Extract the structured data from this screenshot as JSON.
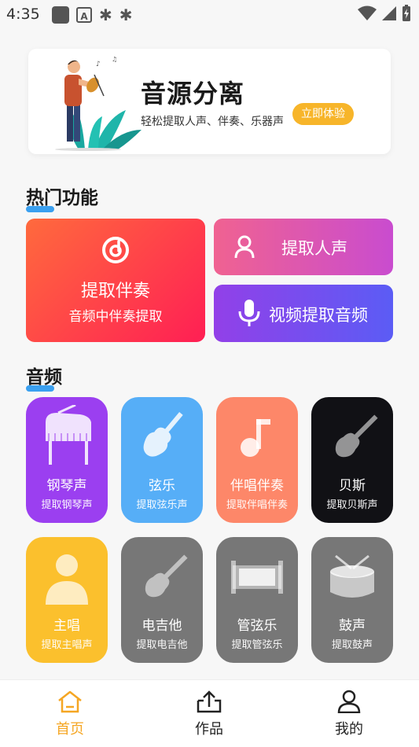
{
  "status_bar": {
    "time": "4:35"
  },
  "banner": {
    "title": "音源分离",
    "subtitle": "轻松提取人声、伴奏、乐器声",
    "button": "立即体验"
  },
  "hot": {
    "title": "热门功能",
    "big": {
      "title": "提取伴奏",
      "subtitle": "音频中伴奏提取"
    },
    "vocal": {
      "title": "提取人声"
    },
    "video": {
      "title": "视频提取音频"
    }
  },
  "audio": {
    "title": "音频",
    "tiles": [
      {
        "name": "钢琴声",
        "desc": "提取钢琴声",
        "icon": "piano-icon",
        "color": "#9b3ff0"
      },
      {
        "name": "弦乐",
        "desc": "提取弦乐声",
        "icon": "violin-icon",
        "color": "#56aef7"
      },
      {
        "name": "伴唱伴奏",
        "desc": "提取伴唱伴奏",
        "icon": "music-note-icon",
        "color": "#fd8769"
      },
      {
        "name": "贝斯",
        "desc": "提取贝斯声",
        "icon": "bass-guitar-icon",
        "color": "#111115"
      },
      {
        "name": "主唱",
        "desc": "提取主唱声",
        "icon": "singer-icon",
        "color": "#fbc02d"
      },
      {
        "name": "电吉他",
        "desc": "提取电吉他",
        "icon": "electric-guitar-icon",
        "color": "#777777"
      },
      {
        "name": "管弦乐",
        "desc": "提取管弦乐",
        "icon": "orchestra-icon",
        "color": "#777777"
      },
      {
        "name": "鼓声",
        "desc": "提取鼓声",
        "icon": "drum-icon",
        "color": "#777777"
      }
    ]
  },
  "nav": {
    "items": [
      {
        "label": "首页",
        "active": true,
        "color": "#f5a623"
      },
      {
        "label": "作品",
        "active": false
      },
      {
        "label": "我的",
        "active": false
      }
    ]
  }
}
